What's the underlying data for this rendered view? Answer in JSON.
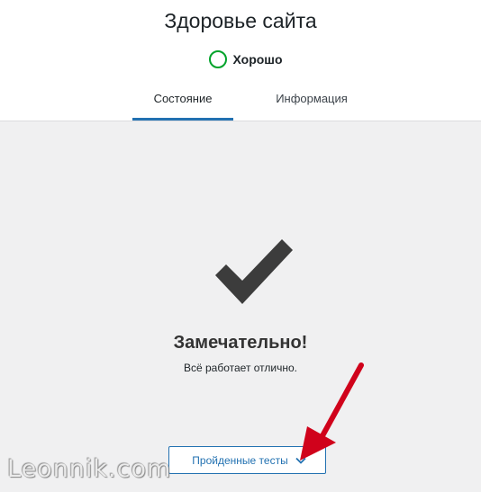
{
  "header": {
    "title": "Здоровье сайта",
    "status_label": "Хорошо",
    "status_color": "#00a32a",
    "tabs": [
      {
        "label": "Состояние",
        "active": true
      },
      {
        "label": "Информация",
        "active": false
      }
    ]
  },
  "main": {
    "icon": "checkmark-icon",
    "title": "Замечательно!",
    "description": "Всё работает отлично.",
    "passed_button_label": "Пройденные тесты",
    "passed_button_icon": "chevron-down-icon"
  },
  "colors": {
    "accent": "#2271b1",
    "background": "#f0f0f1",
    "annotation_arrow": "#d0021b"
  },
  "watermark": {
    "text": "Leonnik.com"
  }
}
